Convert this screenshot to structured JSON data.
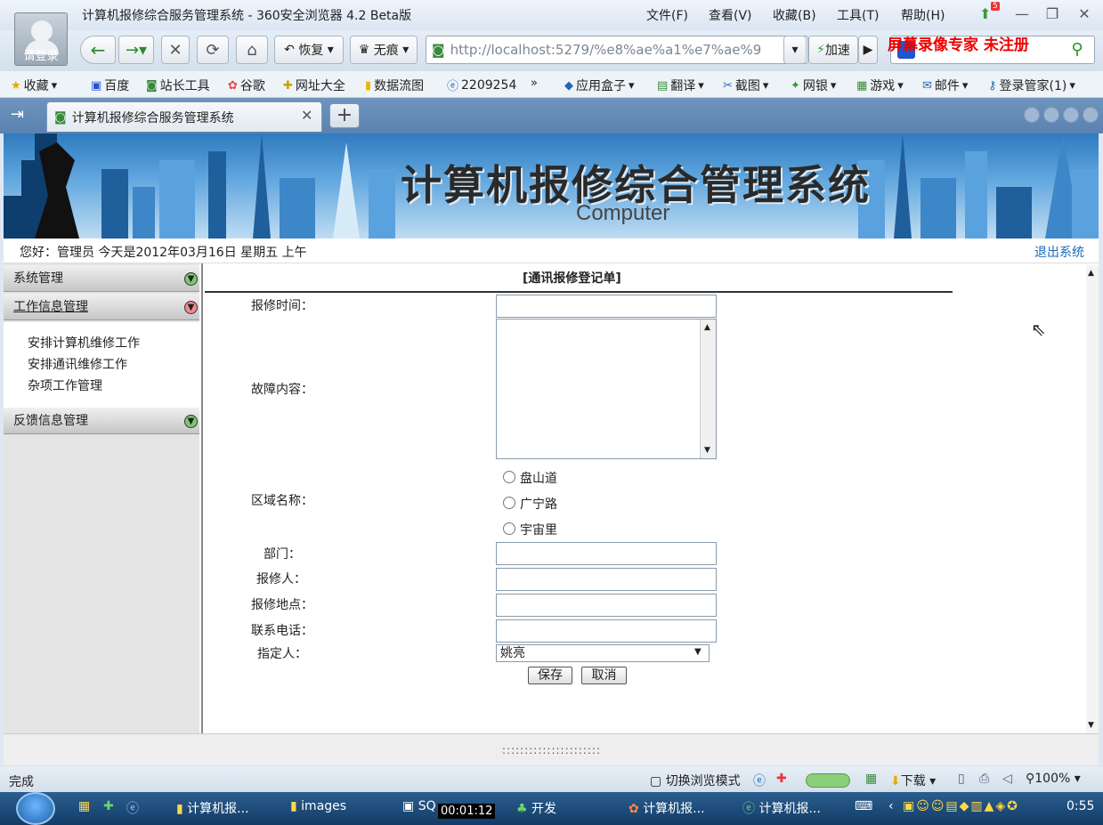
{
  "browser": {
    "window_title": "计算机报修综合服务管理系统 - 360安全浏览器 4.2 Beta版",
    "avatar_label": "请登录",
    "menus": [
      "文件(F)",
      "查看(V)",
      "收藏(B)",
      "工具(T)",
      "帮助(H)"
    ],
    "badge_count": "5",
    "restore_label": "恢复",
    "private_label": "无痕",
    "url": "http://localhost:5279/%e8%ae%a1%e7%ae%9",
    "speedup_label": "加速",
    "watermark": "屏幕录像专家  未注册",
    "bookmarks": [
      "收藏",
      "百度",
      "站长工具",
      "谷歌",
      "网址大全",
      "数据流图",
      "2209254",
      "应用盒子",
      "翻译",
      "截图",
      "网银",
      "游戏",
      "邮件",
      "登录管家(1)"
    ],
    "tab_title": "计算机报修综合服务管理系统",
    "status_text": "完成",
    "status_items": [
      "切换浏览模式",
      "下载",
      "100%"
    ]
  },
  "banner": {
    "title": "计算机报修综合管理系统",
    "subtitle": "Computer"
  },
  "header": {
    "greeting": "您好：管理员    今天是2012年03月16日   星期五   上午",
    "logout": "退出系统"
  },
  "sidebar": {
    "sections": [
      {
        "label": "系统管理",
        "state": "collapsed"
      },
      {
        "label": "工作信息管理",
        "state": "expanded"
      },
      {
        "label": "反馈信息管理",
        "state": "collapsed"
      }
    ],
    "items": [
      "安排计算机维修工作",
      "安排通讯维修工作",
      "杂项工作管理"
    ]
  },
  "form": {
    "title": "[通讯报修登记单]",
    "labels": {
      "repair_time": "报修时间：",
      "fault": "故障内容：",
      "area": "区域名称：",
      "department": "部门：",
      "reporter": "报修人：",
      "location": "报修地点：",
      "phone": "联系电话：",
      "assignee": "指定人："
    },
    "area_options": [
      "盘山道",
      "广宁路",
      "宇宙里"
    ],
    "assignee_value": "姚亮",
    "save": "保存",
    "cancel": "取消"
  },
  "taskbar": {
    "tasks": [
      "计算机报...",
      "images",
      "SQ",
      "开发",
      "计算机报...",
      "计算机报..."
    ],
    "timer": "00:01:12",
    "clock": "0:55"
  },
  "colors": {
    "accent": "#1a6ab4",
    "watermark": "#e00000",
    "tabstrip": "#5a82b0",
    "taskbar": "#123c66"
  }
}
